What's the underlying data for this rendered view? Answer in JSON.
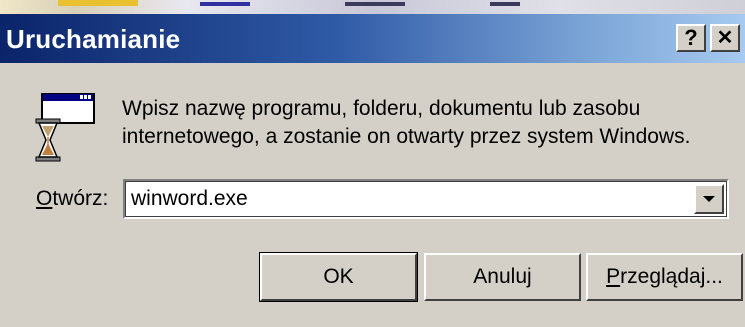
{
  "window": {
    "title": "Uruchamianie",
    "help_button": "?",
    "close_button": "✕"
  },
  "message": {
    "line1": "Wpisz nazwę programu, folderu, dokumentu lub zasobu",
    "line2": "internetowego, a zostanie on otwarty przez system Windows."
  },
  "open_field": {
    "label_accesskey": "O",
    "label_rest": "twórz:",
    "value": "winword.exe"
  },
  "buttons": {
    "ok": "OK",
    "cancel": "Anuluj",
    "browse_accesskey": "P",
    "browse_rest": "rzeglądaj..."
  },
  "colors": {
    "titlebar_start": "#0b246a",
    "titlebar_end": "#a6caf0",
    "face": "#d4d0c8"
  },
  "icons": [
    "run-program-icon",
    "chevron-down-icon"
  ]
}
